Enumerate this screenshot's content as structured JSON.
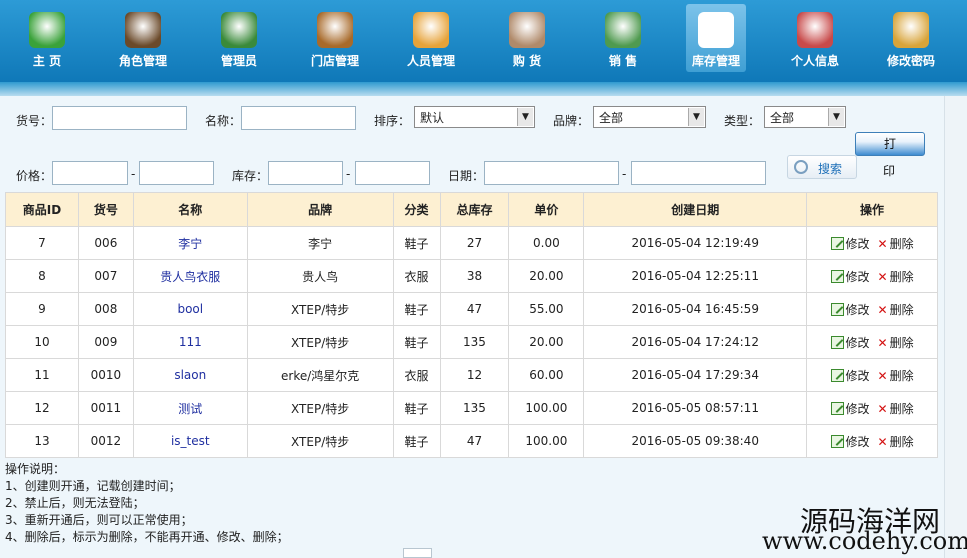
{
  "nav": {
    "items": [
      {
        "label": "主 页",
        "icon": "home-icon",
        "color": "#3aa23a",
        "active": false
      },
      {
        "label": "角色管理",
        "icon": "role-user-icon",
        "color": "#6b4a2a",
        "active": false
      },
      {
        "label": "管理员",
        "icon": "admin-user-icon",
        "color": "#3a8a3a",
        "active": false
      },
      {
        "label": "门店管理",
        "icon": "store-icon",
        "color": "#a86a2a",
        "active": false
      },
      {
        "label": "人员管理",
        "icon": "staff-icon",
        "color": "#e7a33a",
        "active": false
      },
      {
        "label": "购 货",
        "icon": "purchase-clipboard-icon",
        "color": "#b08a6a",
        "active": false
      },
      {
        "label": "销 售",
        "icon": "sales-book-icon",
        "color": "#4f9a4f",
        "active": false
      },
      {
        "label": "库存管理",
        "icon": "inventory-document-icon",
        "color": "#ffffff",
        "active": true
      },
      {
        "label": "个人信息",
        "icon": "personal-info-icon",
        "color": "#c84a4a",
        "active": false
      },
      {
        "label": "修改密码",
        "icon": "password-lock-icon",
        "color": "#d8a43a",
        "active": false
      }
    ]
  },
  "filters": {
    "sku_label": "货号：",
    "name_label": "名称：",
    "sort_label": "排序：",
    "sort_value": "默认",
    "brand_label": "品牌：",
    "brand_value": "全部",
    "type_label": "类型：",
    "type_value": "全部",
    "price_label": "价格：",
    "stock_label": "库存：",
    "date_label": "日期：",
    "range_sep": "-",
    "search_label": "搜索",
    "print_label": "打",
    "print_label_2": "印"
  },
  "table": {
    "headers": [
      "商品ID",
      "货号",
      "名称",
      "品牌",
      "分类",
      "总库存",
      "单价",
      "创建日期",
      "操作"
    ],
    "edit_label": "修改",
    "delete_label": "删除",
    "rows": [
      {
        "id": "7",
        "sku": "006",
        "name": "李宁",
        "brand": "李宁",
        "category": "鞋子",
        "stock": "27",
        "price": "0.00",
        "created": "2016-05-04 12:19:49"
      },
      {
        "id": "8",
        "sku": "007",
        "name": "贵人鸟衣服",
        "brand": "贵人鸟",
        "category": "衣服",
        "stock": "38",
        "price": "20.00",
        "created": "2016-05-04 12:25:11"
      },
      {
        "id": "9",
        "sku": "008",
        "name": "bool",
        "brand": "XTEP/特步",
        "category": "鞋子",
        "stock": "47",
        "price": "55.00",
        "created": "2016-05-04 16:45:59"
      },
      {
        "id": "10",
        "sku": "009",
        "name": "111",
        "brand": "XTEP/特步",
        "category": "鞋子",
        "stock": "135",
        "price": "20.00",
        "created": "2016-05-04 17:24:12"
      },
      {
        "id": "11",
        "sku": "0010",
        "name": "slaon",
        "brand": "erke/鸿星尔克",
        "category": "衣服",
        "stock": "12",
        "price": "60.00",
        "created": "2016-05-04 17:29:34"
      },
      {
        "id": "12",
        "sku": "0011",
        "name": "测试",
        "brand": "XTEP/特步",
        "category": "鞋子",
        "stock": "135",
        "price": "100.00",
        "created": "2016-05-05 08:57:11"
      },
      {
        "id": "13",
        "sku": "0012",
        "name": "is_test",
        "brand": "XTEP/特步",
        "category": "鞋子",
        "stock": "47",
        "price": "100.00",
        "created": "2016-05-05 09:38:40"
      }
    ]
  },
  "notes": {
    "title": "操作说明：",
    "lines": [
      "1、创建则开通，记载创建时间；",
      "2、禁止后，则无法登陆；",
      "3、重新开通后，则可以正常使用；",
      "4、删除后，标示为删除，不能再开通、修改、删除；"
    ]
  },
  "watermark": {
    "line1": "源码海洋网",
    "line2": "www.codehy.com"
  }
}
